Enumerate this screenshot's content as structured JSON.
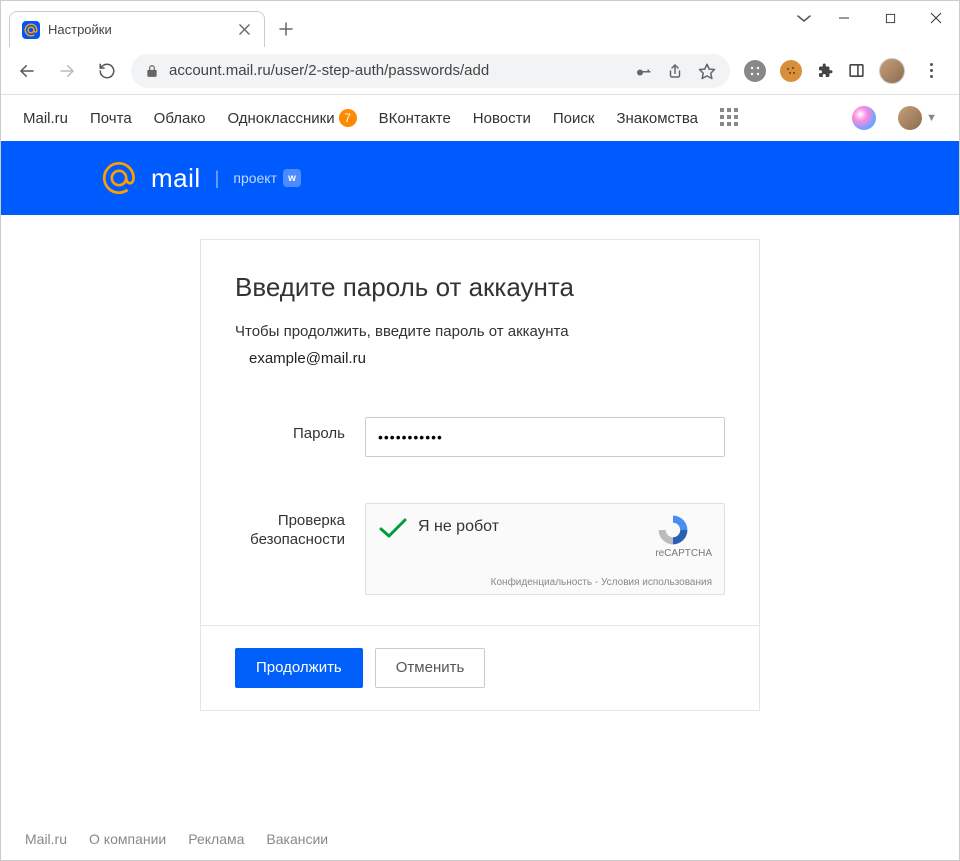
{
  "tab": {
    "title": "Настройки"
  },
  "omnibox": {
    "url": "account.mail.ru/user/2-step-auth/passwords/add"
  },
  "sitenav": {
    "items": [
      "Mail.ru",
      "Почта",
      "Облако",
      "Одноклассники",
      "ВКонтакте",
      "Новости",
      "Поиск",
      "Знакомства"
    ],
    "badge": "7"
  },
  "brandbar": {
    "word": "mail",
    "project": "проект"
  },
  "form": {
    "title": "Введите пароль от аккаунта",
    "subtitle": "Чтобы продолжить, введите пароль от аккаунта",
    "account": "example@mail.ru",
    "password_label": "Пароль",
    "password_value": "•••••••••••",
    "security_label_l1": "Проверка",
    "security_label_l2": "безопасности",
    "captcha_text": "Я не робот",
    "captcha_brand": "reCAPTCHA",
    "captcha_privacy": "Конфиденциальность",
    "captcha_terms": "Условия использования",
    "continue": "Продолжить",
    "cancel": "Отменить"
  },
  "footer": {
    "links": [
      "Mail.ru",
      "О компании",
      "Реклама",
      "Вакансии"
    ]
  }
}
